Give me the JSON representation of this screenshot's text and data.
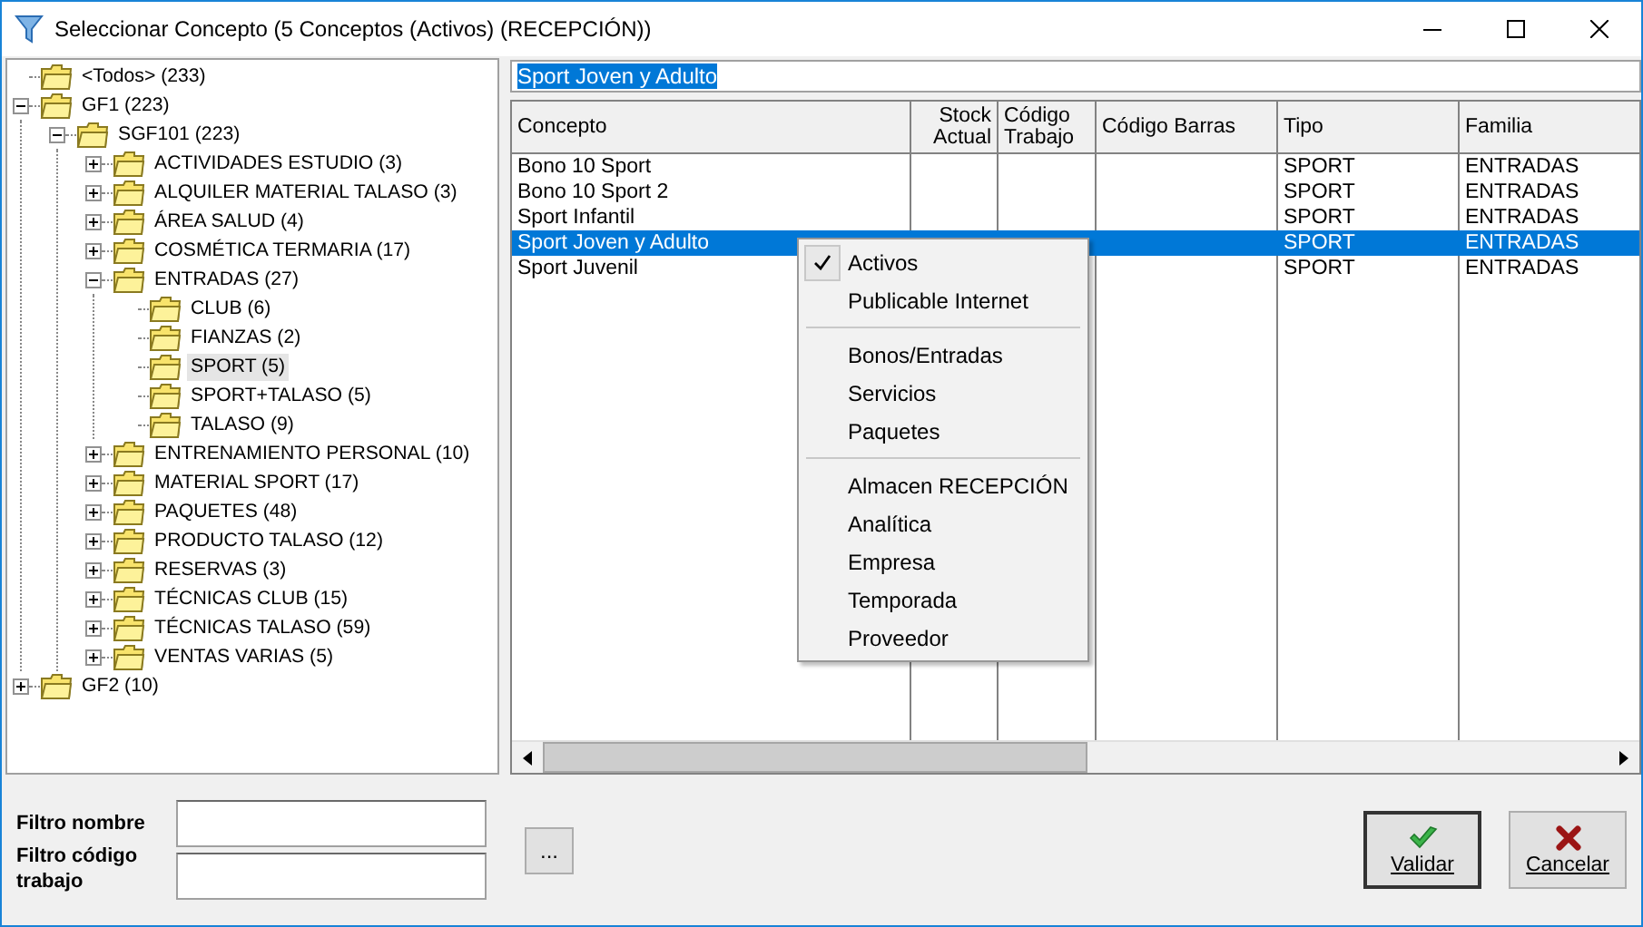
{
  "window": {
    "title": "Seleccionar Concepto (5 Conceptos (Activos) (RECEPCIÓN))"
  },
  "tree": [
    {
      "label": "<Todos> (233)",
      "selected": false
    },
    {
      "label": "GF1 (223)",
      "selected": false,
      "expanded": true,
      "children": [
        {
          "label": "SGF101 (223)",
          "selected": false,
          "expanded": true,
          "children": [
            {
              "label": "ACTIVIDADES ESTUDIO (3)",
              "selected": false,
              "expanded": false
            },
            {
              "label": "ALQUILER MATERIAL TALASO (3)",
              "selected": false,
              "expanded": false
            },
            {
              "label": "ÁREA SALUD (4)",
              "selected": false,
              "expanded": false
            },
            {
              "label": "COSMÉTICA TERMARIA (17)",
              "selected": false,
              "expanded": false
            },
            {
              "label": "ENTRADAS (27)",
              "selected": false,
              "expanded": true,
              "children": [
                {
                  "label": "CLUB (6)",
                  "selected": false
                },
                {
                  "label": "FIANZAS (2)",
                  "selected": false
                },
                {
                  "label": "SPORT (5)",
                  "selected": true
                },
                {
                  "label": "SPORT+TALASO (5)",
                  "selected": false
                },
                {
                  "label": "TALASO (9)",
                  "selected": false
                }
              ]
            },
            {
              "label": "ENTRENAMIENTO PERSONAL (10)",
              "selected": false,
              "expanded": false
            },
            {
              "label": "MATERIAL SPORT (17)",
              "selected": false,
              "expanded": false
            },
            {
              "label": "PAQUETES (48)",
              "selected": false,
              "expanded": false
            },
            {
              "label": "PRODUCTO TALASO (12)",
              "selected": false,
              "expanded": false
            },
            {
              "label": "RESERVAS (3)",
              "selected": false,
              "expanded": false
            },
            {
              "label": "TÉCNICAS CLUB (15)",
              "selected": false,
              "expanded": false
            },
            {
              "label": "TÉCNICAS TALASO (59)",
              "selected": false,
              "expanded": false
            },
            {
              "label": "VENTAS VARIAS (5)",
              "selected": false,
              "expanded": false
            }
          ]
        }
      ]
    },
    {
      "label": "GF2 (10)",
      "selected": false,
      "expanded": false
    }
  ],
  "search": {
    "value": "Sport Joven y Adulto"
  },
  "table": {
    "columns": [
      {
        "label": "Concepto"
      },
      {
        "label": "Stock Actual"
      },
      {
        "label": "Código Trabajo"
      },
      {
        "label": "Código Barras"
      },
      {
        "label": "Tipo"
      },
      {
        "label": "Familia"
      }
    ],
    "rows": [
      {
        "cells": [
          "Bono 10 Sport",
          "",
          "",
          "",
          "SPORT",
          "ENTRADAS"
        ],
        "selected": false
      },
      {
        "cells": [
          "Bono 10 Sport 2",
          "",
          "",
          "",
          "SPORT",
          "ENTRADAS"
        ],
        "selected": false
      },
      {
        "cells": [
          "Sport Infantil",
          "",
          "",
          "",
          "SPORT",
          "ENTRADAS"
        ],
        "selected": false
      },
      {
        "cells": [
          "Sport Joven y Adulto",
          "",
          "",
          "",
          "SPORT",
          "ENTRADAS"
        ],
        "selected": true
      },
      {
        "cells": [
          "Sport Juvenil",
          "",
          "",
          "",
          "SPORT",
          "ENTRADAS"
        ],
        "selected": false
      }
    ]
  },
  "context_menu": [
    {
      "kind": "item",
      "label": "Activos",
      "checked": true
    },
    {
      "kind": "item",
      "label": "Publicable Internet",
      "checked": false
    },
    {
      "kind": "separator"
    },
    {
      "kind": "item",
      "label": "Bonos/Entradas",
      "checked": false
    },
    {
      "kind": "item",
      "label": "Servicios",
      "checked": false
    },
    {
      "kind": "item",
      "label": "Paquetes",
      "checked": false
    },
    {
      "kind": "separator"
    },
    {
      "kind": "item",
      "label": "Almacen RECEPCIÓN",
      "checked": false
    },
    {
      "kind": "item",
      "label": "Analítica",
      "checked": false
    },
    {
      "kind": "item",
      "label": "Empresa",
      "checked": false
    },
    {
      "kind": "item",
      "label": "Temporada",
      "checked": false
    },
    {
      "kind": "item",
      "label": "Proveedor",
      "checked": false
    }
  ],
  "filters": [
    {
      "label": "Filtro nombre"
    },
    {
      "label": "Filtro código trabajo"
    }
  ],
  "more_button": "...",
  "buttons": [
    {
      "kind": "ok",
      "label": "Validar"
    },
    {
      "kind": "cancel",
      "label": "Cancelar"
    }
  ]
}
